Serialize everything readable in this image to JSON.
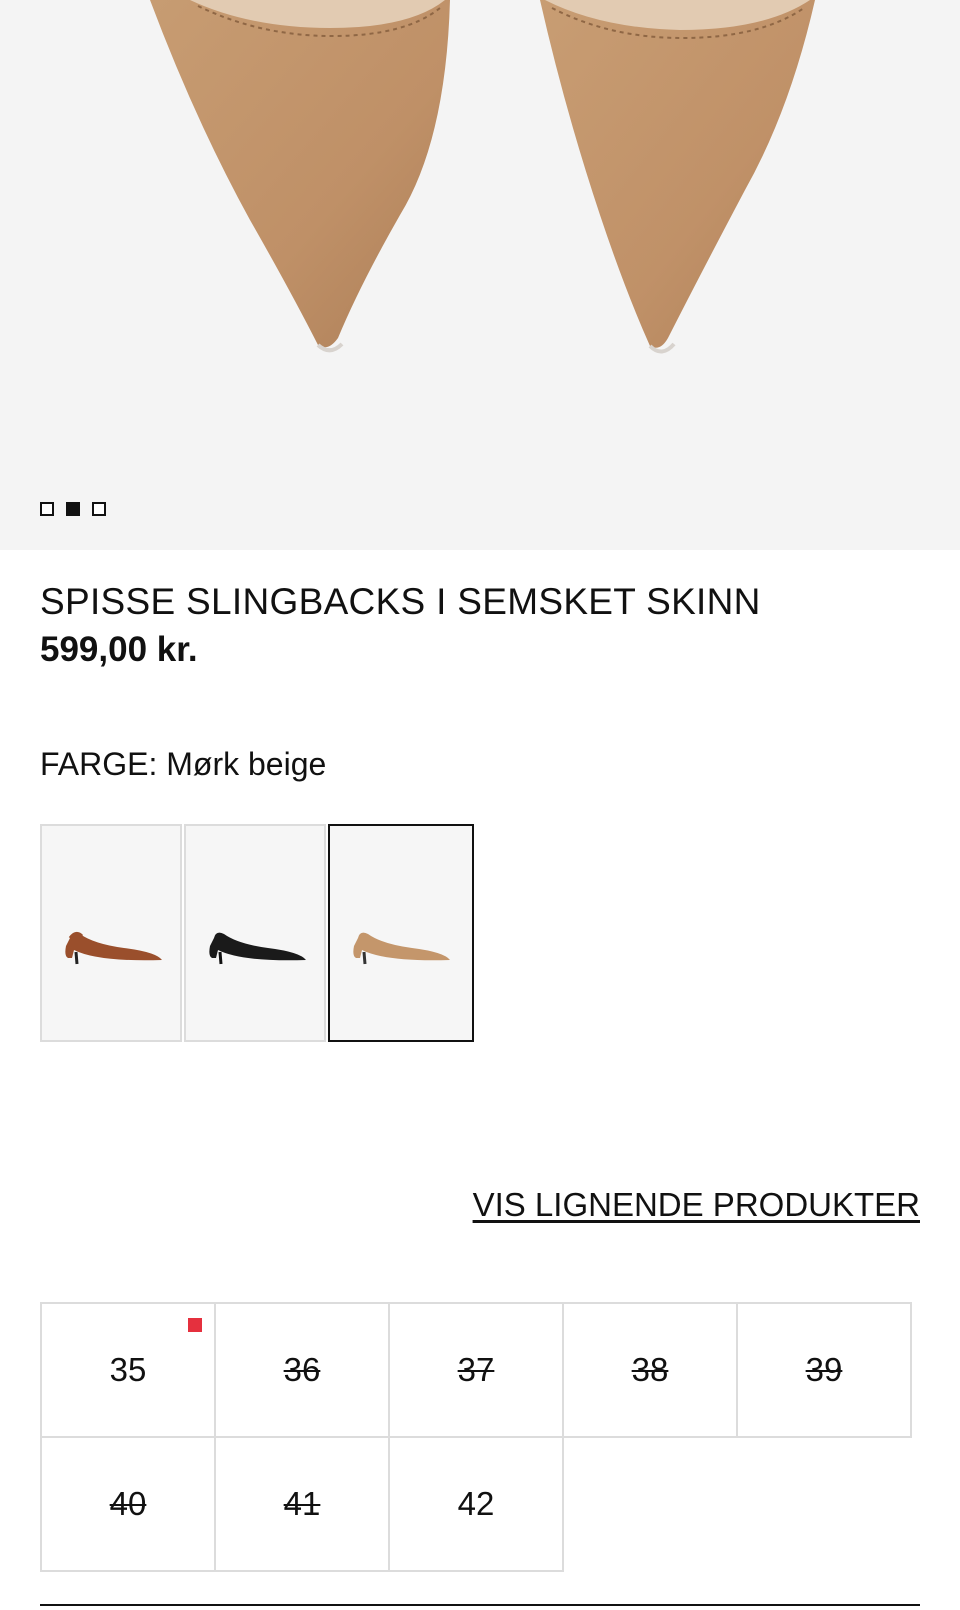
{
  "product": {
    "title": "SPISSE SLINGBACKS I SEMSKET SKINN",
    "price": "599,00 kr."
  },
  "gallery": {
    "total_images": 3,
    "active_index": 1
  },
  "color": {
    "label": "FARGE: Mørk beige",
    "options": [
      {
        "name": "brown",
        "hex": "#9a4f2c"
      },
      {
        "name": "black",
        "hex": "#1a1a1a"
      },
      {
        "name": "dark beige",
        "hex": "#c4966b"
      }
    ],
    "selected_index": 2
  },
  "similar_link": "VIS LIGNENDE PRODUKTER",
  "sizes": [
    {
      "label": "35",
      "available": true,
      "low_stock": true
    },
    {
      "label": "36",
      "available": false
    },
    {
      "label": "37",
      "available": false
    },
    {
      "label": "38",
      "available": false
    },
    {
      "label": "39",
      "available": false
    },
    {
      "label": "40",
      "available": false
    },
    {
      "label": "41",
      "available": false
    },
    {
      "label": "42",
      "available": true
    }
  ],
  "colors": {
    "suede": "#c4966b",
    "low_stock_indicator": "#e5303e",
    "text": "#111111",
    "border": "#dcdcdc"
  }
}
